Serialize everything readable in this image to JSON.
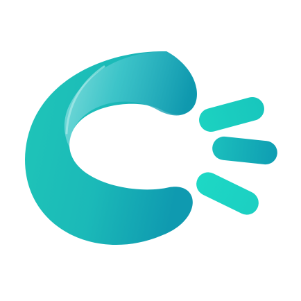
{
  "logo": {
    "icon": "letter-c-with-signal-rays-icon",
    "colors": {
      "background": "#ffffff",
      "primary": "#1fc4b7",
      "primary_dark": "#0f9fb0",
      "accent_bright": "#1fd6c4",
      "highlight": "#7fdde0"
    }
  }
}
